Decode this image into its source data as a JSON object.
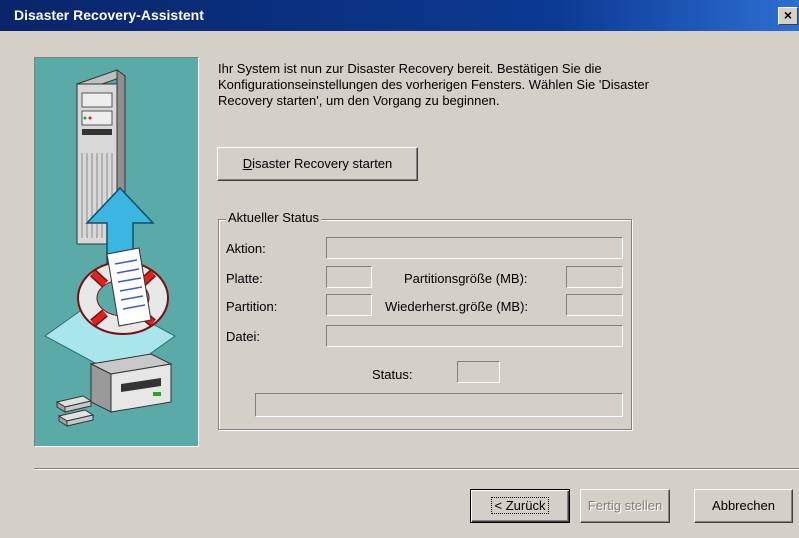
{
  "window": {
    "title": "Disaster Recovery-Assistent",
    "close_glyph": "×"
  },
  "intro_text": "Ihr System ist nun zur Disaster Recovery bereit. Bestätigen Sie die Konfigurationseinstellungen des vorherigen Fensters. Wählen Sie 'Disaster Recovery starten', um den Vorgang zu beginnen.",
  "start_button": {
    "label": "Disaster Recovery starten",
    "mnemonic": "D"
  },
  "status_group": {
    "title": "Aktueller Status",
    "fields": {
      "aktion": {
        "label": "Aktion:",
        "value": ""
      },
      "platte": {
        "label": "Platte:",
        "value": ""
      },
      "partition": {
        "label": "Partition:",
        "value": ""
      },
      "partitionsgroesse": {
        "label": "Partitionsgröße (MB):",
        "value": ""
      },
      "wiederherstgroesse": {
        "label": "Wiederherst.größe (MB):",
        "value": ""
      },
      "datei": {
        "label": "Datei:",
        "value": ""
      },
      "status": {
        "label": "Status:",
        "value": ""
      }
    }
  },
  "footer": {
    "back": {
      "label": "< Zurück",
      "enabled": true
    },
    "finish": {
      "label": "Fertig stellen",
      "enabled": false
    },
    "cancel": {
      "label": "Abbrechen",
      "enabled": true
    }
  },
  "icons": [
    "server-tower-icon",
    "upload-arrow-icon",
    "life-ring-icon",
    "document-icon",
    "tape-drive-icon",
    "tape-cartridge-icon"
  ],
  "colors": {
    "title_bar": "#0a246a",
    "illustration_bg": "#5aaaa8",
    "dialog_bg": "#d4d0c8"
  }
}
